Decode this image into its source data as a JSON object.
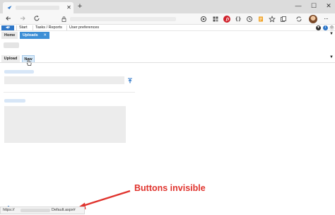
{
  "browser": {
    "new_tab_glyph": "+",
    "tab_close_glyph": "✕",
    "minimize_glyph": "—",
    "maximize_glyph": "☐",
    "close_glyph": "✕",
    "extensions": [
      "coin-extension-icon",
      "grid-extension-icon",
      "pinterest-icon",
      "braces-icon",
      "history-icon",
      "reader-icon",
      "favorites-icon",
      "collections-icon"
    ],
    "accent_color": "#2f77c8"
  },
  "app_menu": {
    "items": [
      "Start",
      "Tasks / Reports",
      "User preferences"
    ]
  },
  "page_tabs": {
    "home": "Home",
    "uploads": "Uploads",
    "close_glyph": "✕",
    "overflow_glyph": "▼"
  },
  "toolbar": {
    "upload_label": "Upload",
    "new_label": "New",
    "collapse_glyph": "▼"
  },
  "annotation": {
    "text": "Buttons invisible",
    "color": "#e0332d"
  },
  "status_bar": {
    "prefix": "https://",
    "suffix": "Default.aspx#"
  }
}
